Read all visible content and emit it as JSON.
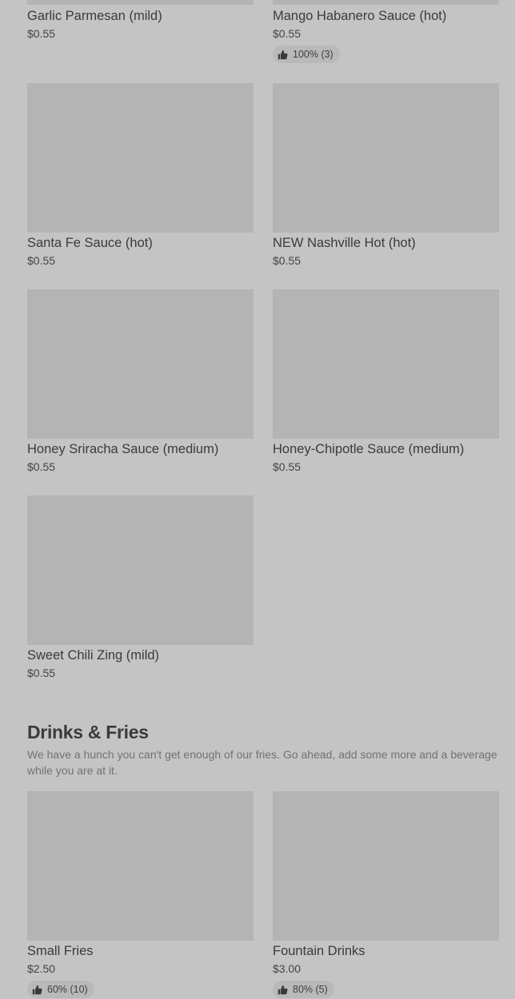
{
  "sauces": [
    {
      "name": "Garlic Parmesan (mild)",
      "price": "$0.55"
    },
    {
      "name": "Mango Habanero Sauce (hot)",
      "price": "$0.55",
      "rating": "100% (3)"
    },
    {
      "name": "Santa Fe Sauce (hot)",
      "price": "$0.55"
    },
    {
      "name": "NEW Nashville Hot (hot)",
      "price": "$0.55"
    },
    {
      "name": "Honey Sriracha Sauce (medium)",
      "price": "$0.55"
    },
    {
      "name": "Honey-Chipotle Sauce (medium)",
      "price": "$0.55"
    },
    {
      "name": "Sweet Chili Zing (mild)",
      "price": "$0.55"
    }
  ],
  "drinks_section": {
    "title": "Drinks & Fries",
    "description": "We have a hunch you can't get enough of our fries. Go ahead, add some more and a beverage while you are at it.",
    "items": [
      {
        "name": "Small Fries",
        "price": "$2.50",
        "rating": "60% (10)"
      },
      {
        "name": "Fountain Drinks",
        "price": "$3.00",
        "rating": "80% (5)"
      }
    ]
  },
  "icons": {
    "rating": "thumbs-up-icon"
  }
}
